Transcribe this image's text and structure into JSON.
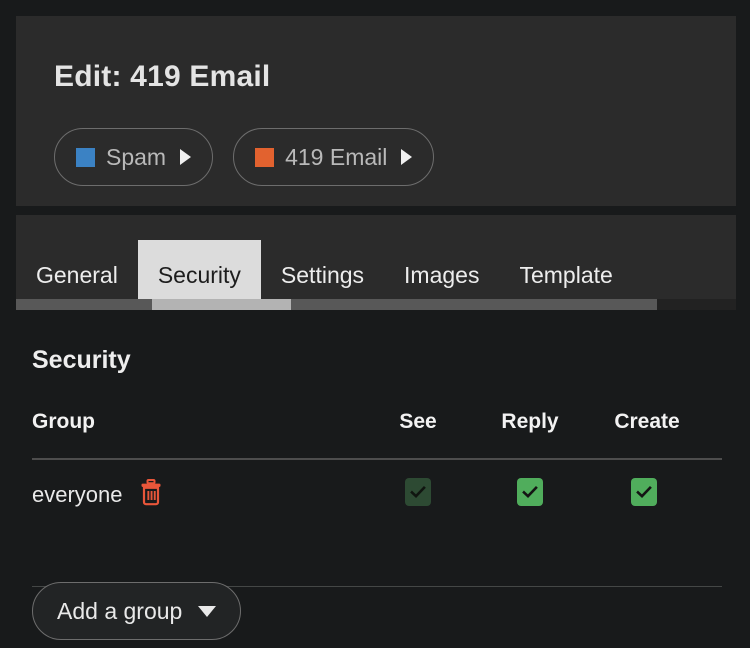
{
  "header": {
    "title": "Edit: 419 Email",
    "breadcrumbs": [
      {
        "label": "Spam",
        "color": "#3b82c4",
        "arrow_icon": "triangle-right-icon"
      },
      {
        "label": "419 Email",
        "color": "#e2622f",
        "arrow_icon": "triangle-right-icon"
      }
    ]
  },
  "tabs": [
    {
      "label": "General",
      "active": false
    },
    {
      "label": "Security",
      "active": true
    },
    {
      "label": "Settings",
      "active": false
    },
    {
      "label": "Images",
      "active": false
    },
    {
      "label": "Template",
      "active": false
    }
  ],
  "security": {
    "section_title": "Security",
    "columns": [
      "Group",
      "See",
      "Reply",
      "Create"
    ],
    "rows": [
      {
        "group": "everyone",
        "delete_icon": "trash-icon",
        "see": true,
        "reply": true,
        "create": true
      }
    ],
    "add_group_label": "Add a group",
    "add_group_caret": "caret-down-icon"
  },
  "colors": {
    "checkbox_checked": "#50ad5c",
    "checkbox_disabled": "#2d4a33",
    "delete_icon": "#e8563a",
    "tab_active_bg": "#dcdcdc",
    "panel_bg": "#2b2b2b",
    "page_bg": "#181a1b"
  }
}
